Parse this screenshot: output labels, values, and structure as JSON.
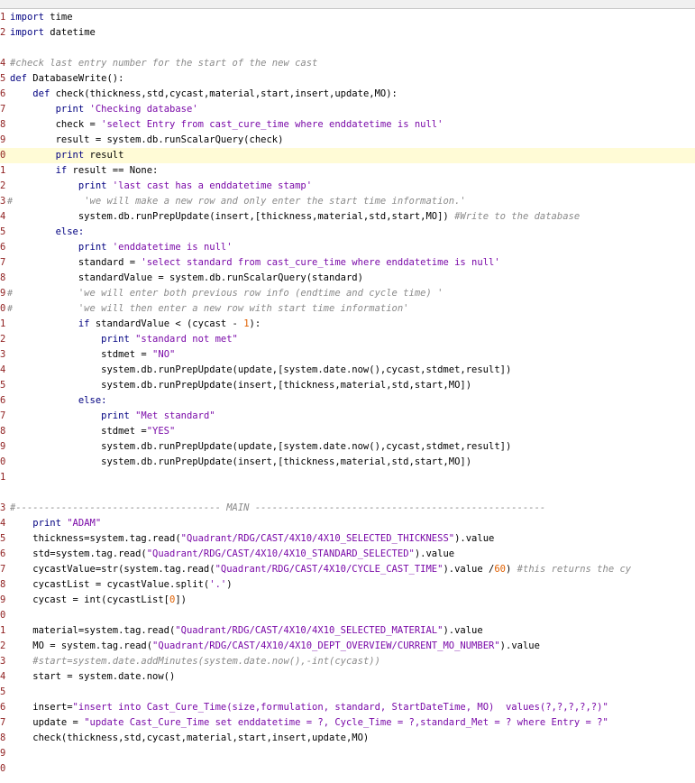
{
  "colors": {
    "keyword": "#000080",
    "string": "#7a0aa8",
    "comment": "#8a8a8a",
    "line_number": "#8f1f1f",
    "current_line": "#fffbd6"
  },
  "current_line_index": 9,
  "lines": [
    {
      "n": "1",
      "fold": "",
      "segs": [
        [
          "kw",
          "import"
        ],
        [
          "t",
          " time"
        ]
      ]
    },
    {
      "n": "2",
      "fold": "",
      "segs": [
        [
          "kw",
          "import"
        ],
        [
          "t",
          " datetime"
        ]
      ]
    },
    {
      "n": "",
      "fold": "",
      "segs": []
    },
    {
      "n": "4",
      "fold": "",
      "segs": [
        [
          "cm",
          "#check last entry number for the start of the new cast"
        ]
      ]
    },
    {
      "n": "5",
      "fold": "",
      "segs": [
        [
          "kw",
          "def"
        ],
        [
          "t",
          " DatabaseWrite():"
        ]
      ]
    },
    {
      "n": "6",
      "fold": "",
      "segs": [
        [
          "t",
          "    "
        ],
        [
          "kw",
          "def"
        ],
        [
          "t",
          " check(thickness,std,cycast,material,start,insert,update,MO):"
        ]
      ]
    },
    {
      "n": "7",
      "fold": "",
      "segs": [
        [
          "t",
          "        "
        ],
        [
          "kw",
          "print"
        ],
        [
          "t",
          " "
        ],
        [
          "st",
          "'Checking database'"
        ]
      ]
    },
    {
      "n": "8",
      "fold": "",
      "segs": [
        [
          "t",
          "        check = "
        ],
        [
          "st",
          "'select Entry from cast_cure_time where enddatetime is null'"
        ]
      ]
    },
    {
      "n": "9",
      "fold": "",
      "segs": [
        [
          "t",
          "        result = system.db.runScalarQuery(check)"
        ]
      ]
    },
    {
      "n": "0",
      "fold": "",
      "segs": [
        [
          "t",
          "        "
        ],
        [
          "kw",
          "print"
        ],
        [
          "t",
          " result"
        ]
      ]
    },
    {
      "n": "1",
      "fold": "",
      "segs": [
        [
          "t",
          "        "
        ],
        [
          "kw",
          "if"
        ],
        [
          "t",
          " result == None:"
        ]
      ]
    },
    {
      "n": "2",
      "fold": "",
      "segs": [
        [
          "t",
          "            "
        ],
        [
          "kw",
          "print"
        ],
        [
          "t",
          " "
        ],
        [
          "st",
          "'last cast has a enddatetime stamp'"
        ]
      ]
    },
    {
      "n": "3",
      "fold": "#",
      "segs": [
        [
          "t",
          "             "
        ],
        [
          "cm",
          "'we will make a new row and only enter the start time information.'"
        ]
      ]
    },
    {
      "n": "4",
      "fold": "",
      "segs": [
        [
          "t",
          "            system.db.runPrepUpdate(insert,[thickness,material,std,start,MO]) "
        ],
        [
          "cm",
          "#Write to the database"
        ]
      ]
    },
    {
      "n": "5",
      "fold": "",
      "segs": [
        [
          "t",
          "        "
        ],
        [
          "kw",
          "else:"
        ]
      ]
    },
    {
      "n": "6",
      "fold": "",
      "segs": [
        [
          "t",
          "            "
        ],
        [
          "kw",
          "print"
        ],
        [
          "t",
          " "
        ],
        [
          "st",
          "'enddatetime is null'"
        ]
      ]
    },
    {
      "n": "7",
      "fold": "",
      "segs": [
        [
          "t",
          "            standard = "
        ],
        [
          "st",
          "'select standard from cast_cure_time where enddatetime is null'"
        ]
      ]
    },
    {
      "n": "8",
      "fold": "",
      "segs": [
        [
          "t",
          "            standardValue = system.db.runScalarQuery(standard)"
        ]
      ]
    },
    {
      "n": "9",
      "fold": "#",
      "segs": [
        [
          "t",
          "            "
        ],
        [
          "cm",
          "'we will enter both previous row info (endtime and cycle time) '"
        ]
      ]
    },
    {
      "n": "0",
      "fold": "#",
      "segs": [
        [
          "t",
          "            "
        ],
        [
          "cm",
          "'we will then enter a new row with start time information'"
        ]
      ]
    },
    {
      "n": "1",
      "fold": "",
      "segs": [
        [
          "t",
          "            "
        ],
        [
          "kw",
          "if"
        ],
        [
          "t",
          " standardValue < (cycast - "
        ],
        [
          "num",
          "1"
        ],
        [
          "t",
          "):"
        ]
      ]
    },
    {
      "n": "2",
      "fold": "",
      "segs": [
        [
          "t",
          "                "
        ],
        [
          "kw",
          "print"
        ],
        [
          "t",
          " "
        ],
        [
          "st",
          "\"standard not met\""
        ]
      ]
    },
    {
      "n": "3",
      "fold": "",
      "segs": [
        [
          "t",
          "                stdmet = "
        ],
        [
          "st",
          "\"NO\""
        ]
      ]
    },
    {
      "n": "4",
      "fold": "",
      "segs": [
        [
          "t",
          "                system.db.runPrepUpdate(update,[system.date.now(),cycast,stdmet,result])"
        ]
      ]
    },
    {
      "n": "5",
      "fold": "",
      "segs": [
        [
          "t",
          "                system.db.runPrepUpdate(insert,[thickness,material,std,start,MO])"
        ]
      ]
    },
    {
      "n": "6",
      "fold": "",
      "segs": [
        [
          "t",
          "            "
        ],
        [
          "kw",
          "else:"
        ]
      ]
    },
    {
      "n": "7",
      "fold": "",
      "segs": [
        [
          "t",
          "                "
        ],
        [
          "kw",
          "print"
        ],
        [
          "t",
          " "
        ],
        [
          "st",
          "\"Met standard\""
        ]
      ]
    },
    {
      "n": "8",
      "fold": "",
      "segs": [
        [
          "t",
          "                stdmet ="
        ],
        [
          "st",
          "\"YES\""
        ]
      ]
    },
    {
      "n": "9",
      "fold": "",
      "segs": [
        [
          "t",
          "                system.db.runPrepUpdate(update,[system.date.now(),cycast,stdmet,result])"
        ]
      ]
    },
    {
      "n": "0",
      "fold": "",
      "segs": [
        [
          "t",
          "                system.db.runPrepUpdate(insert,[thickness,material,std,start,MO])"
        ]
      ]
    },
    {
      "n": "1",
      "fold": "",
      "segs": []
    },
    {
      "n": "",
      "fold": "",
      "segs": []
    },
    {
      "n": "3",
      "fold": "",
      "segs": [
        [
          "cm",
          "#------------------------------------ MAIN ---------------------------------------------------"
        ]
      ]
    },
    {
      "n": "4",
      "fold": "",
      "segs": [
        [
          "t",
          "    "
        ],
        [
          "kw",
          "print"
        ],
        [
          "t",
          " "
        ],
        [
          "st",
          "\"ADAM\""
        ]
      ]
    },
    {
      "n": "5",
      "fold": "",
      "segs": [
        [
          "t",
          "    thickness=system.tag.read("
        ],
        [
          "st",
          "\"Quadrant/RDG/CAST/4X10/4X10_SELECTED_THICKNESS\""
        ],
        [
          "t",
          ").value"
        ]
      ]
    },
    {
      "n": "6",
      "fold": "",
      "segs": [
        [
          "t",
          "    std=system.tag.read("
        ],
        [
          "st",
          "\"Quadrant/RDG/CAST/4X10/4X10_STANDARD_SELECTED\""
        ],
        [
          "t",
          ").value"
        ]
      ]
    },
    {
      "n": "7",
      "fold": "",
      "segs": [
        [
          "t",
          "    cycastValue=str(system.tag.read("
        ],
        [
          "st",
          "\"Quadrant/RDG/CAST/4X10/CYCLE_CAST_TIME\""
        ],
        [
          "t",
          ").value /"
        ],
        [
          "num",
          "60"
        ],
        [
          "t",
          ") "
        ],
        [
          "cm",
          "#this returns the cy"
        ]
      ]
    },
    {
      "n": "8",
      "fold": "",
      "segs": [
        [
          "t",
          "    cycastList = cycastValue.split("
        ],
        [
          "st",
          "'.'"
        ],
        [
          "t",
          ")"
        ]
      ]
    },
    {
      "n": "9",
      "fold": "",
      "segs": [
        [
          "t",
          "    cycast = int(cycastList["
        ],
        [
          "num",
          "0"
        ],
        [
          "t",
          "])"
        ]
      ]
    },
    {
      "n": "0",
      "fold": "",
      "segs": []
    },
    {
      "n": "1",
      "fold": "",
      "segs": [
        [
          "t",
          "    material=system.tag.read("
        ],
        [
          "st",
          "\"Quadrant/RDG/CAST/4X10/4X10_SELECTED_MATERIAL\""
        ],
        [
          "t",
          ").value"
        ]
      ]
    },
    {
      "n": "2",
      "fold": "",
      "segs": [
        [
          "t",
          "    MO = system.tag.read("
        ],
        [
          "st",
          "\"Quadrant/RDG/CAST/4X10/4X10_DEPT_OVERVIEW/CURRENT_MO_NUMBER\""
        ],
        [
          "t",
          ").value"
        ]
      ]
    },
    {
      "n": "3",
      "fold": "",
      "segs": [
        [
          "t",
          "    "
        ],
        [
          "cm",
          "#start=system.date.addMinutes(system.date.now(),-int(cycast))"
        ]
      ]
    },
    {
      "n": "4",
      "fold": "",
      "segs": [
        [
          "t",
          "    start = system.date.now()"
        ]
      ]
    },
    {
      "n": "5",
      "fold": "",
      "segs": []
    },
    {
      "n": "6",
      "fold": "",
      "segs": [
        [
          "t",
          "    insert="
        ],
        [
          "st",
          "\"insert into Cast_Cure_Time(size,formulation, standard, StartDateTime, MO)  values(?,?,?,?,?)\""
        ]
      ]
    },
    {
      "n": "7",
      "fold": "",
      "segs": [
        [
          "t",
          "    update = "
        ],
        [
          "st",
          "\"update Cast_Cure_Time set enddatetime = ?, Cycle_Time = ?,standard_Met = ? where Entry = ?\""
        ]
      ]
    },
    {
      "n": "8",
      "fold": "",
      "segs": [
        [
          "t",
          "    check(thickness,std,cycast,material,start,insert,update,MO)"
        ]
      ]
    },
    {
      "n": "9",
      "fold": "",
      "segs": []
    },
    {
      "n": "0",
      "fold": "",
      "segs": []
    }
  ]
}
